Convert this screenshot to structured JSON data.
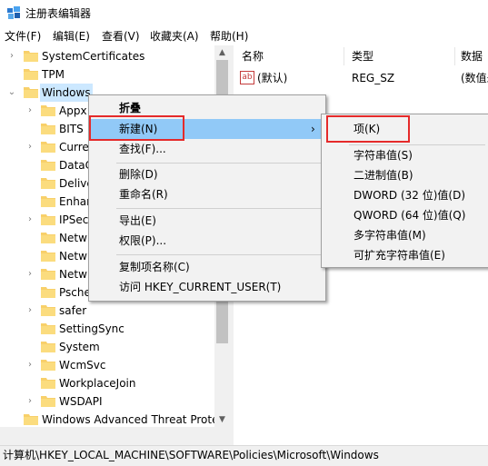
{
  "window": {
    "title": "注册表编辑器"
  },
  "menubar": [
    "文件(F)",
    "编辑(E)",
    "查看(V)",
    "收藏夹(A)",
    "帮助(H)"
  ],
  "tree": {
    "items": [
      {
        "label": "SystemCertificates"
      },
      {
        "label": "TPM"
      },
      {
        "label": "Windows"
      },
      {
        "label": "Appx"
      },
      {
        "label": "BITS"
      },
      {
        "label": "Curre"
      },
      {
        "label": "DataC"
      },
      {
        "label": "Delive"
      },
      {
        "label": "Enhar"
      },
      {
        "label": "IPSec"
      },
      {
        "label": "Netw"
      },
      {
        "label": "Netw"
      },
      {
        "label": "Netw"
      },
      {
        "label": "Psche"
      },
      {
        "label": "safer"
      },
      {
        "label": "SettingSync"
      },
      {
        "label": "System"
      },
      {
        "label": "WcmSvc"
      },
      {
        "label": "WorkplaceJoin"
      },
      {
        "label": "WSDAPI"
      },
      {
        "label": "Windows Advanced Threat Prote"
      }
    ]
  },
  "list": {
    "columns": [
      "名称",
      "类型",
      "数据"
    ],
    "rows": [
      {
        "name": "(默认)",
        "type": "REG_SZ",
        "data": "(数值未"
      }
    ],
    "value_icon_text": "ab"
  },
  "context_menu": {
    "items": [
      "折叠",
      "新建(N)",
      "查找(F)...",
      "删除(D)",
      "重命名(R)",
      "导出(E)",
      "权限(P)...",
      "复制项名称(C)",
      "访问 HKEY_CURRENT_USER(T)"
    ],
    "submenu_arrow": "›"
  },
  "submenu": {
    "items": [
      "项(K)",
      "字符串值(S)",
      "二进制值(B)",
      "DWORD (32 位)值(D)",
      "QWORD (64 位)值(Q)",
      "多字符串值(M)",
      "可扩充字符串值(E)"
    ]
  },
  "statusbar": {
    "path": "计算机\\HKEY_LOCAL_MACHINE\\SOFTWARE\\Policies\\Microsoft\\Windows"
  },
  "colors": {
    "highlight": "#91c9f7",
    "annotation_box": "#e52a2a",
    "folder": "#f8d06a"
  }
}
